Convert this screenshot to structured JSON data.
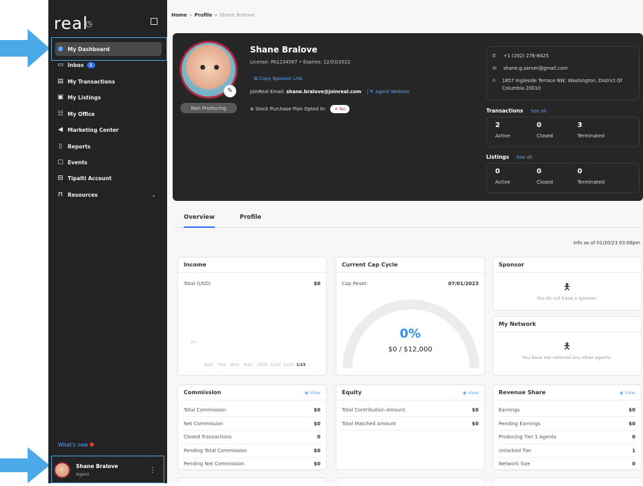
{
  "sidebar": {
    "logo": "real",
    "items": [
      {
        "label": "My Dashboard",
        "icon": "person-icon"
      },
      {
        "label": "Inbox",
        "icon": "inbox-icon",
        "badge": "1"
      },
      {
        "label": "My Transactions",
        "icon": "clipboard-icon"
      },
      {
        "label": "My Listings",
        "icon": "listing-icon"
      },
      {
        "label": "My Office",
        "icon": "office-icon"
      },
      {
        "label": "Marketing Center",
        "icon": "megaphone-icon"
      },
      {
        "label": "Reports",
        "icon": "report-icon"
      },
      {
        "label": "Events",
        "icon": "calendar-icon"
      },
      {
        "label": "Tipalti Account",
        "icon": "wallet-icon"
      },
      {
        "label": "Resources",
        "icon": "briefcase-icon"
      }
    ],
    "whats_new": "What's new",
    "user": {
      "name": "Shane Bralove",
      "role": "Agent"
    }
  },
  "breadcrumb": {
    "home": "Home",
    "profile": "Profile",
    "current": "Shane Bralove",
    "sep": ">"
  },
  "profile": {
    "name": "Shane Bralove",
    "license": "License: PA1234567  •  Expires: 12/03/2022",
    "sponsor_link": "Copy Sponsor Link",
    "email_label": "JoinReal Email:",
    "email": "shane.bralove@joinreal.com",
    "agent_website": "Agent Website",
    "stock_plan": "Stock Purchase Plan Opted In:",
    "stock_value": "No",
    "status": "Non Producing",
    "phone": "+1 (202) 276-8425",
    "contact_email": "shane.g.sarver@gmail.com",
    "address": "1857 Ingleside Terrace NW, Washington, District Of Columbia 20010"
  },
  "transactions": {
    "title": "Transactions",
    "see_all": "See all",
    "active": "2",
    "closed": "0",
    "terminated": "3",
    "active_label": "Active",
    "closed_label": "Closed",
    "terminated_label": "Terminated"
  },
  "listings": {
    "title": "Listings",
    "see_all": "See all",
    "active": "0",
    "closed": "0",
    "terminated": "0",
    "active_label": "Active",
    "closed_label": "Closed",
    "terminated_label": "Terminated"
  },
  "tabs": {
    "overview": "Overview",
    "profile": "Profile"
  },
  "info_as_of": "Info as of 01/20/23 03:08pm",
  "income": {
    "title": "Income",
    "total_label": "Total (USD)",
    "total": "$0",
    "y_tick": "$0",
    "months": [
      "6/22",
      "7/22",
      "8/22",
      "9/22",
      "10/22",
      "11/22",
      "12/22",
      "1/23"
    ]
  },
  "cap": {
    "title": "Current Cap Cycle",
    "reset_label": "Cap Reset:",
    "reset_date": "07/01/2023",
    "percent": "0%",
    "amount": "$0 / $12,000",
    "percent_value": 0
  },
  "sponsor": {
    "title": "Sponsor",
    "empty": "You do not have a sponsor."
  },
  "network": {
    "title": "My Network",
    "empty": "You have not referred any other agents."
  },
  "commission": {
    "title": "Commission",
    "view": "View",
    "rows": [
      {
        "label": "Total Commission",
        "value": "$0"
      },
      {
        "label": "Net Commission",
        "value": "$0"
      },
      {
        "label": "Closed Transactions",
        "value": "0"
      },
      {
        "label": "Pending Total Commission",
        "value": "$0"
      },
      {
        "label": "Pending Net Commission",
        "value": "$0"
      }
    ]
  },
  "equity": {
    "title": "Equity",
    "view": "View",
    "rows": [
      {
        "label": "Total Contribution Amount",
        "value": "$0"
      },
      {
        "label": "Total Matched Amount",
        "value": "$0"
      }
    ]
  },
  "revshare": {
    "title": "Revenue Share",
    "view": "View",
    "rows": [
      {
        "label": "Earnings",
        "value": "$0"
      },
      {
        "label": "Pending Earnings",
        "value": "$0"
      },
      {
        "label": "Producing Tier 1 Agents",
        "value": "0"
      },
      {
        "label": "Unlocked Tier",
        "value": "1"
      },
      {
        "label": "Network Size",
        "value": "0"
      }
    ]
  },
  "colors": {
    "accent": "#2f6ef2",
    "link": "#5aa6ff",
    "annotation": "#4aa9e6",
    "sidebar": "#232323"
  }
}
